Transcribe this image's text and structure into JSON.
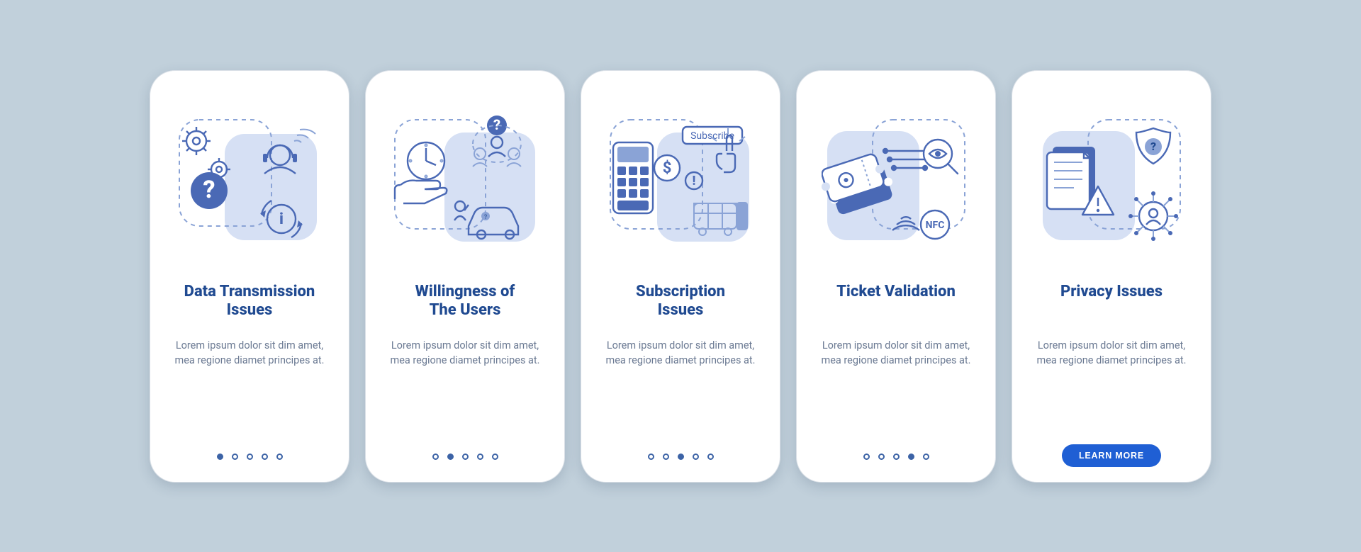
{
  "colors": {
    "accent": "#1f5fd4",
    "heading": "#204a91",
    "body": "#6b7a93",
    "illus_bg": "#d6e0f4",
    "outline_dark": "#4a69b5"
  },
  "default_body_text": "Lorem ipsum dolor sit dim amet, mea regione diamet principes at.",
  "screens": [
    {
      "id": "data-transmission",
      "title": "Data Transmission\nIssues",
      "body": "Lorem ipsum dolor sit dim amet, mea regione diamet principes at.",
      "active_dot_index": 0,
      "illustration": "data-transmission-icon",
      "icon_keywords": [
        "gears",
        "question-mark",
        "headset-person",
        "info-refresh",
        "wifi"
      ]
    },
    {
      "id": "willingness",
      "title": "Willingness of\nThe Users",
      "body": "Lorem ipsum dolor sit dim amet, mea regione diamet principes at.",
      "active_dot_index": 1,
      "illustration": "willingness-icon",
      "icon_keywords": [
        "clock-in-hand",
        "people-question",
        "car",
        "thinking-person"
      ]
    },
    {
      "id": "subscription",
      "title": "Subscription\nIssues",
      "body": "Lorem ipsum dolor sit dim amet, mea regione diamet principes at.",
      "active_dot_index": 2,
      "illustration": "subscription-icon",
      "icon_keywords": [
        "calculator",
        "dollar-coin",
        "subscribe-button",
        "pointer-hand",
        "warning",
        "bus"
      ],
      "subscribe_label": "Subscribe"
    },
    {
      "id": "ticket-validation",
      "title": "Ticket Validation",
      "body": "Lorem ipsum dolor sit dim amet, mea regione diamet principes at.",
      "active_dot_index": 3,
      "illustration": "ticket-validation-icon",
      "icon_keywords": [
        "tickets",
        "magnifier-eye",
        "nfc",
        "signal",
        "circuit-dots"
      ],
      "nfc_label": "NFC"
    },
    {
      "id": "privacy",
      "title": "Privacy Issues",
      "body": "Lorem ipsum dolor sit dim amet, mea regione diamet principes at.",
      "active_dot_index": 4,
      "illustration": "privacy-icon",
      "icon_keywords": [
        "document",
        "warning-triangle",
        "shield-question",
        "user-network"
      ],
      "cta_label": "LEARN MORE"
    }
  ],
  "total_dots": 5
}
